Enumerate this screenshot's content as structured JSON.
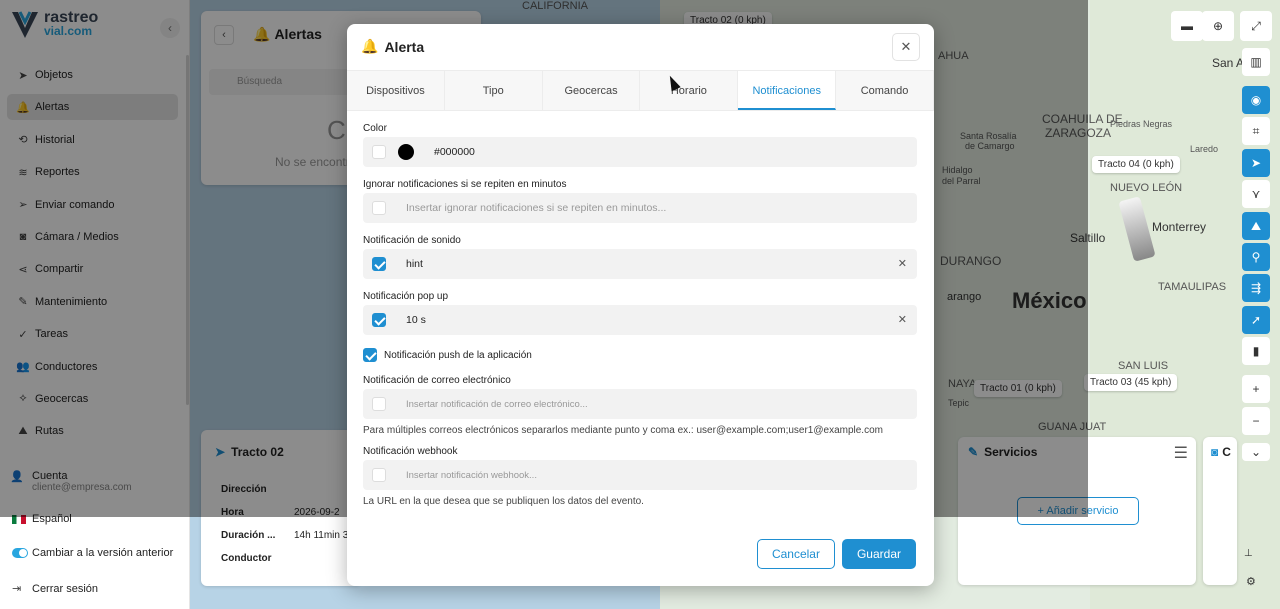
{
  "brand": {
    "line1": "rastreo",
    "line2": "vial.com"
  },
  "sidebar": {
    "items": [
      {
        "icon": "navigation-icon",
        "glyph": "➤",
        "label": "Objetos"
      },
      {
        "icon": "bell-icon",
        "glyph": "🔔",
        "label": "Alertas",
        "active": true
      },
      {
        "icon": "history-icon",
        "glyph": "⟲",
        "label": "Historial"
      },
      {
        "icon": "layers-icon",
        "glyph": "≋",
        "label": "Reportes"
      },
      {
        "icon": "send-icon",
        "glyph": "➢",
        "label": "Enviar comando"
      },
      {
        "icon": "camera-icon",
        "glyph": "◙",
        "label": "Cámara / Medios"
      },
      {
        "icon": "share-icon",
        "glyph": "⋖",
        "label": "Compartir"
      },
      {
        "icon": "wrench-icon",
        "glyph": "✎",
        "label": "Mantenimiento"
      },
      {
        "icon": "checklist-icon",
        "glyph": "✓",
        "label": "Tareas"
      },
      {
        "icon": "users-icon",
        "glyph": "👥",
        "label": "Conductores"
      },
      {
        "icon": "geofence-icon",
        "glyph": "⟡",
        "label": "Geocercas"
      },
      {
        "icon": "road-icon",
        "glyph": "⛰",
        "label": "Rutas"
      }
    ],
    "account_label": "Cuenta",
    "account_email": "cliente@empresa.com",
    "language": "Español",
    "legacy_toggle": "Cambiar a la versión anterior",
    "logout": "Cerrar sesión"
  },
  "alerts_panel": {
    "title": "Alertas",
    "search_placeholder": "Búsqueda",
    "empty_text": "No se encontr",
    "big_char": "C"
  },
  "vehicle_panel": {
    "title": "Tracto 02",
    "rows": [
      {
        "label": "Dirección",
        "value": ""
      },
      {
        "label": "Hora",
        "value": "2026-09-2"
      },
      {
        "label": "Duración ...",
        "value": "14h 11min 3"
      },
      {
        "label": "Conductor",
        "value": ""
      }
    ]
  },
  "services_panel": {
    "title": "Servicios",
    "add_label": "+ Añadir servicio",
    "extra_title": "C"
  },
  "map": {
    "labels": [
      {
        "text": "CALIFORNIA"
      },
      {
        "text": "AHUA"
      },
      {
        "text": "San Ant"
      },
      {
        "text": "COAHUILA DE"
      },
      {
        "text": "ZARAGOZA"
      },
      {
        "text": "Piedras Negras"
      },
      {
        "text": "Santa Rosalía"
      },
      {
        "text": "de Camargo"
      },
      {
        "text": "Laredo"
      },
      {
        "text": "Hidalgo"
      },
      {
        "text": "del Parral"
      },
      {
        "text": "Saltillo"
      },
      {
        "text": "Monterrey"
      },
      {
        "text": "NUEVO LEÓN"
      },
      {
        "text": "DURANGO"
      },
      {
        "text": "TAMAULIPAS"
      },
      {
        "text": "arango"
      },
      {
        "text": "SAN LUIS"
      },
      {
        "text": "Tepic"
      },
      {
        "text": "GUANA JUAT"
      },
      {
        "text": "NAYA"
      }
    ],
    "country": "México",
    "vehicles": [
      "Tracto 02 (0 kph)",
      "Tracto 04 (0 kph)",
      "Tracto 01 (0 kph)",
      "Tracto 03 (45 kph)"
    ]
  },
  "modal": {
    "title": "Alerta",
    "tabs": [
      "Dispositivos",
      "Tipo",
      "Geocercas",
      "Horario",
      "Notificaciones",
      "Comando"
    ],
    "active_tab": "Notificaciones",
    "color_label": "Color",
    "color_value": "#000000",
    "ignore_label": "Ignorar notificaciones si se repiten en minutos",
    "ignore_placeholder": "Insertar ignorar notificaciones si se repiten en minutos...",
    "sound_label": "Notificación de sonido",
    "sound_value": "hint",
    "popup_label": "Notificación pop up",
    "popup_value": "10 s",
    "push_label": "Notificación push de la aplicación",
    "email_label": "Notificación de correo electrónico",
    "email_placeholder": "Insertar notificación de correo electrónico...",
    "email_help": "Para múltiples correos electrónicos separarlos mediante punto y coma ex.: user@example.com;user1@example.com",
    "webhook_label": "Notificación webhook",
    "webhook_placeholder": "Insertar notificación webhook...",
    "webhook_help": "La URL en la que desea que se publiquen los datos del evento.",
    "cancel": "Cancelar",
    "save": "Guardar"
  },
  "colors": {
    "accent": "#1f8fd1",
    "brand_dark": "#3a4557"
  }
}
